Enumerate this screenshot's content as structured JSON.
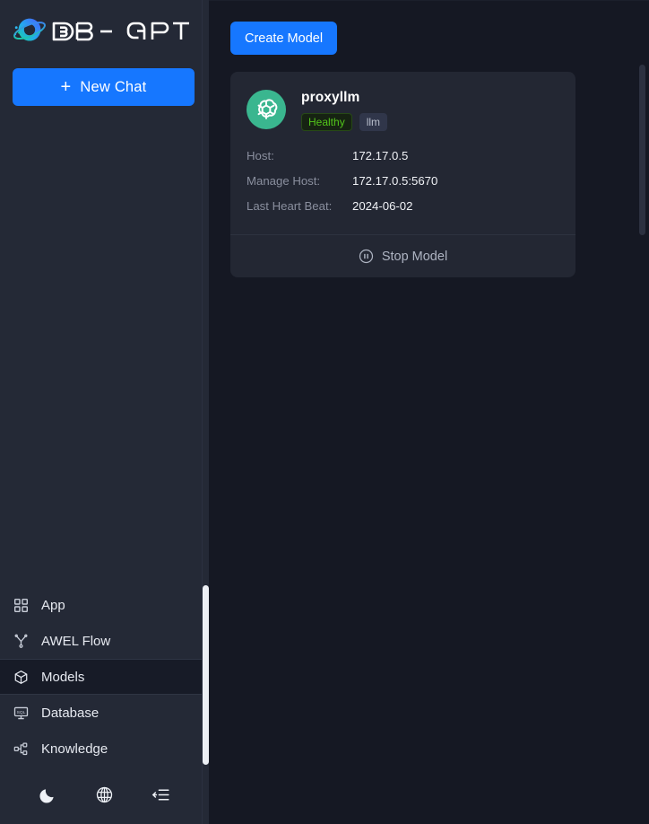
{
  "app": {
    "brand_name": "DB-GPT",
    "new_chat_label": "New Chat",
    "plus_glyph": "+"
  },
  "sidebar": {
    "items": [
      {
        "label": "App",
        "icon": "grid-icon",
        "active": false
      },
      {
        "label": "AWEL Flow",
        "icon": "flow-fork-icon",
        "active": false
      },
      {
        "label": "Models",
        "icon": "cube-icon",
        "active": true
      },
      {
        "label": "Database",
        "icon": "sql-monitor-icon",
        "active": false
      },
      {
        "label": "Knowledge",
        "icon": "nodes-icon",
        "active": false
      }
    ],
    "bottom_actions": [
      {
        "name": "dark-mode-toggle",
        "icon": "moon-icon"
      },
      {
        "name": "language-switcher",
        "icon": "globe-icon"
      },
      {
        "name": "collapse-sidebar",
        "icon": "collapse-panel-icon"
      }
    ]
  },
  "main": {
    "create_button_label": "Create Model",
    "cards": [
      {
        "avatar_icon": "openai-logo-icon",
        "avatar_color": "#3ab68f",
        "name": "proxyllm",
        "badges": [
          {
            "label": "Healthy",
            "kind": "healthy",
            "color": "#52c41a"
          },
          {
            "label": "llm",
            "kind": "type",
            "color": "#b9bfcc"
          }
        ],
        "info": [
          {
            "label": "Host:",
            "value": "172.17.0.5"
          },
          {
            "label": "Manage Host:",
            "value": "172.17.0.5:5670"
          },
          {
            "label": "Last Heart Beat:",
            "value": "2024-06-02"
          }
        ],
        "action_label": "Stop Model",
        "action_icon": "pause-circle-icon"
      }
    ]
  },
  "colors": {
    "accent": "#1677ff",
    "page_bg": "#151823",
    "sidebar_bg": "#242936",
    "card_bg": "#232733",
    "healthy": "#52c41a"
  }
}
